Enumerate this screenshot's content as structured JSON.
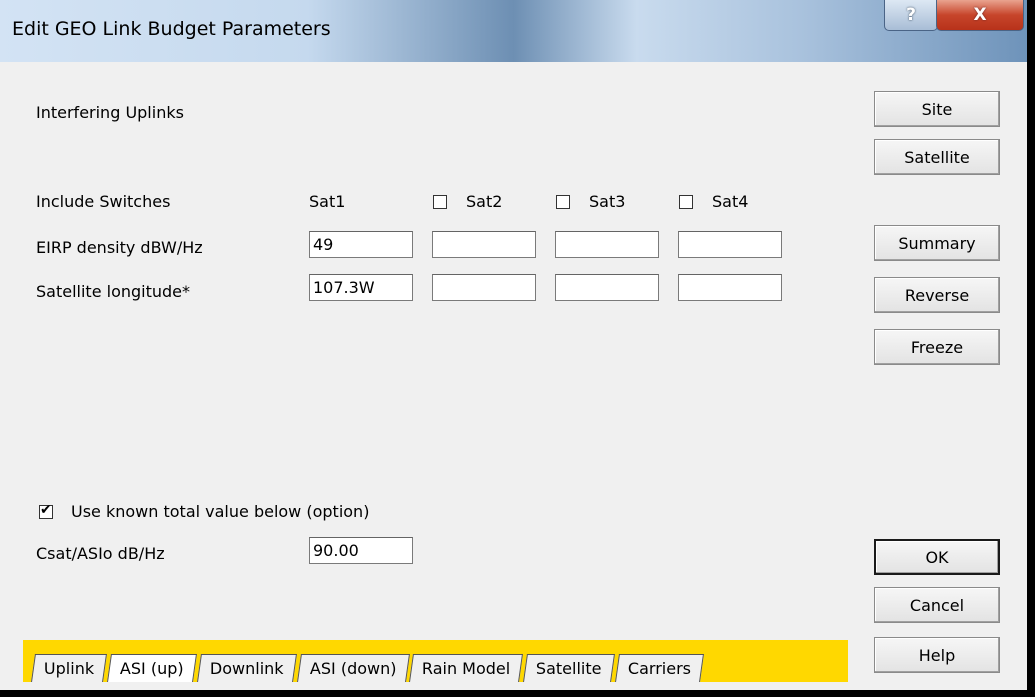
{
  "window": {
    "title": "Edit GEO Link Budget Parameters",
    "help_button": "?",
    "close_button": "X"
  },
  "section_title": "Interfering Uplinks",
  "include_switches": {
    "label": "Include Switches",
    "sats": [
      {
        "label": "Sat1",
        "checkbox": false
      },
      {
        "label": "Sat2",
        "checkbox": true,
        "checked": false
      },
      {
        "label": "Sat3",
        "checkbox": true,
        "checked": false
      },
      {
        "label": "Sat4",
        "checkbox": true,
        "checked": false
      }
    ]
  },
  "eirp": {
    "label": "EIRP density dBW/Hz",
    "values": [
      "49",
      "",
      "",
      ""
    ]
  },
  "longitude": {
    "label": "Satellite longitude*",
    "values": [
      "107.3W",
      "",
      "",
      ""
    ]
  },
  "known_total": {
    "checkbox_label": "Use known total value below (option)",
    "checked": true,
    "field_label": "Csat/ASIo dB/Hz",
    "value": "90.00"
  },
  "side_buttons": {
    "site": "Site",
    "satellite": "Satellite",
    "summary": "Summary",
    "reverse": "Reverse",
    "freeze": "Freeze",
    "ok": "OK",
    "cancel": "Cancel",
    "help": "Help"
  },
  "tabs": [
    "Uplink",
    "ASI (up)",
    "Downlink",
    "ASI (down)",
    "Rain Model",
    "Satellite",
    "Carriers"
  ],
  "active_tab": "ASI (up)",
  "colors": {
    "tab_strip": "#ffd800",
    "dialog_bg": "#f0f0f0",
    "close_button": "#c7452b"
  }
}
